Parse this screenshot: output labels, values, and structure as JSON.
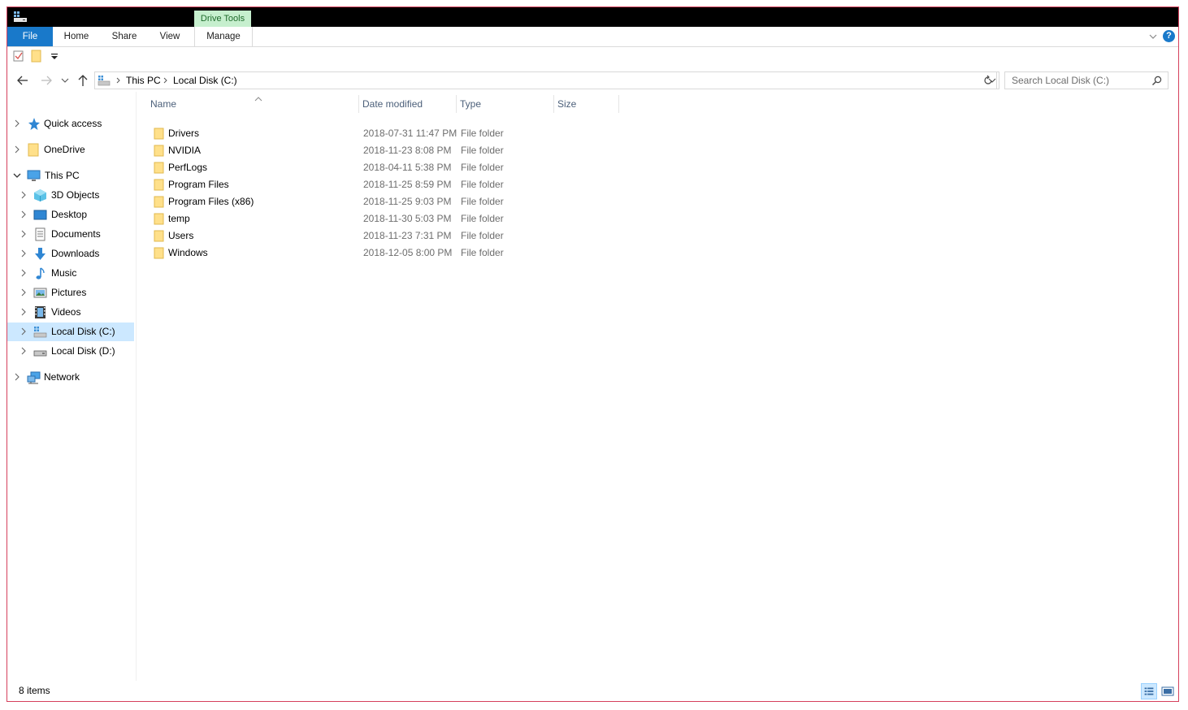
{
  "window": {
    "context_tab": "Drive Tools",
    "accent_color": "#1979ca",
    "border_color": "#d5405c"
  },
  "ribbon": {
    "tabs": [
      "File",
      "Home",
      "Share",
      "View",
      "Manage"
    ],
    "help_label": "?"
  },
  "address": {
    "crumbs": [
      "This PC",
      "Local Disk (C:)"
    ]
  },
  "search": {
    "placeholder": "Search Local Disk (C:)"
  },
  "nav_tree": [
    {
      "label": "Quick access",
      "icon": "star-icon",
      "expanded": false
    },
    {
      "label": "OneDrive",
      "icon": "folder-icon",
      "expanded": false
    },
    {
      "label": "This PC",
      "icon": "computer-icon",
      "expanded": true
    },
    {
      "label": "3D Objects",
      "icon": "cube-icon",
      "expanded": false
    },
    {
      "label": "Desktop",
      "icon": "desktop-icon",
      "expanded": false
    },
    {
      "label": "Documents",
      "icon": "document-icon",
      "expanded": false
    },
    {
      "label": "Downloads",
      "icon": "download-arrow-icon",
      "expanded": false
    },
    {
      "label": "Music",
      "icon": "music-note-icon",
      "expanded": false
    },
    {
      "label": "Pictures",
      "icon": "picture-icon",
      "expanded": false
    },
    {
      "label": "Videos",
      "icon": "film-icon",
      "expanded": false
    },
    {
      "label": "Local Disk (C:)",
      "icon": "drive-windows-icon",
      "expanded": false,
      "selected": true
    },
    {
      "label": "Local Disk (D:)",
      "icon": "drive-icon",
      "expanded": false
    },
    {
      "label": "Network",
      "icon": "network-icon",
      "expanded": false
    }
  ],
  "columns": {
    "name": "Name",
    "date_modified": "Date modified",
    "type": "Type",
    "size": "Size"
  },
  "files": [
    {
      "name": "Drivers",
      "date": "2018-07-31 11:47 PM",
      "type": "File folder"
    },
    {
      "name": "NVIDIA",
      "date": "2018-11-23 8:08 PM",
      "type": "File folder"
    },
    {
      "name": "PerfLogs",
      "date": "2018-04-11 5:38 PM",
      "type": "File folder"
    },
    {
      "name": "Program Files",
      "date": "2018-11-25 8:59 PM",
      "type": "File folder"
    },
    {
      "name": "Program Files (x86)",
      "date": "2018-11-25 9:03 PM",
      "type": "File folder"
    },
    {
      "name": "temp",
      "date": "2018-11-30 5:03 PM",
      "type": "File folder"
    },
    {
      "name": "Users",
      "date": "2018-11-23 7:31 PM",
      "type": "File folder"
    },
    {
      "name": "Windows",
      "date": "2018-12-05 8:00 PM",
      "type": "File folder"
    }
  ],
  "status": {
    "count": "8 items"
  }
}
